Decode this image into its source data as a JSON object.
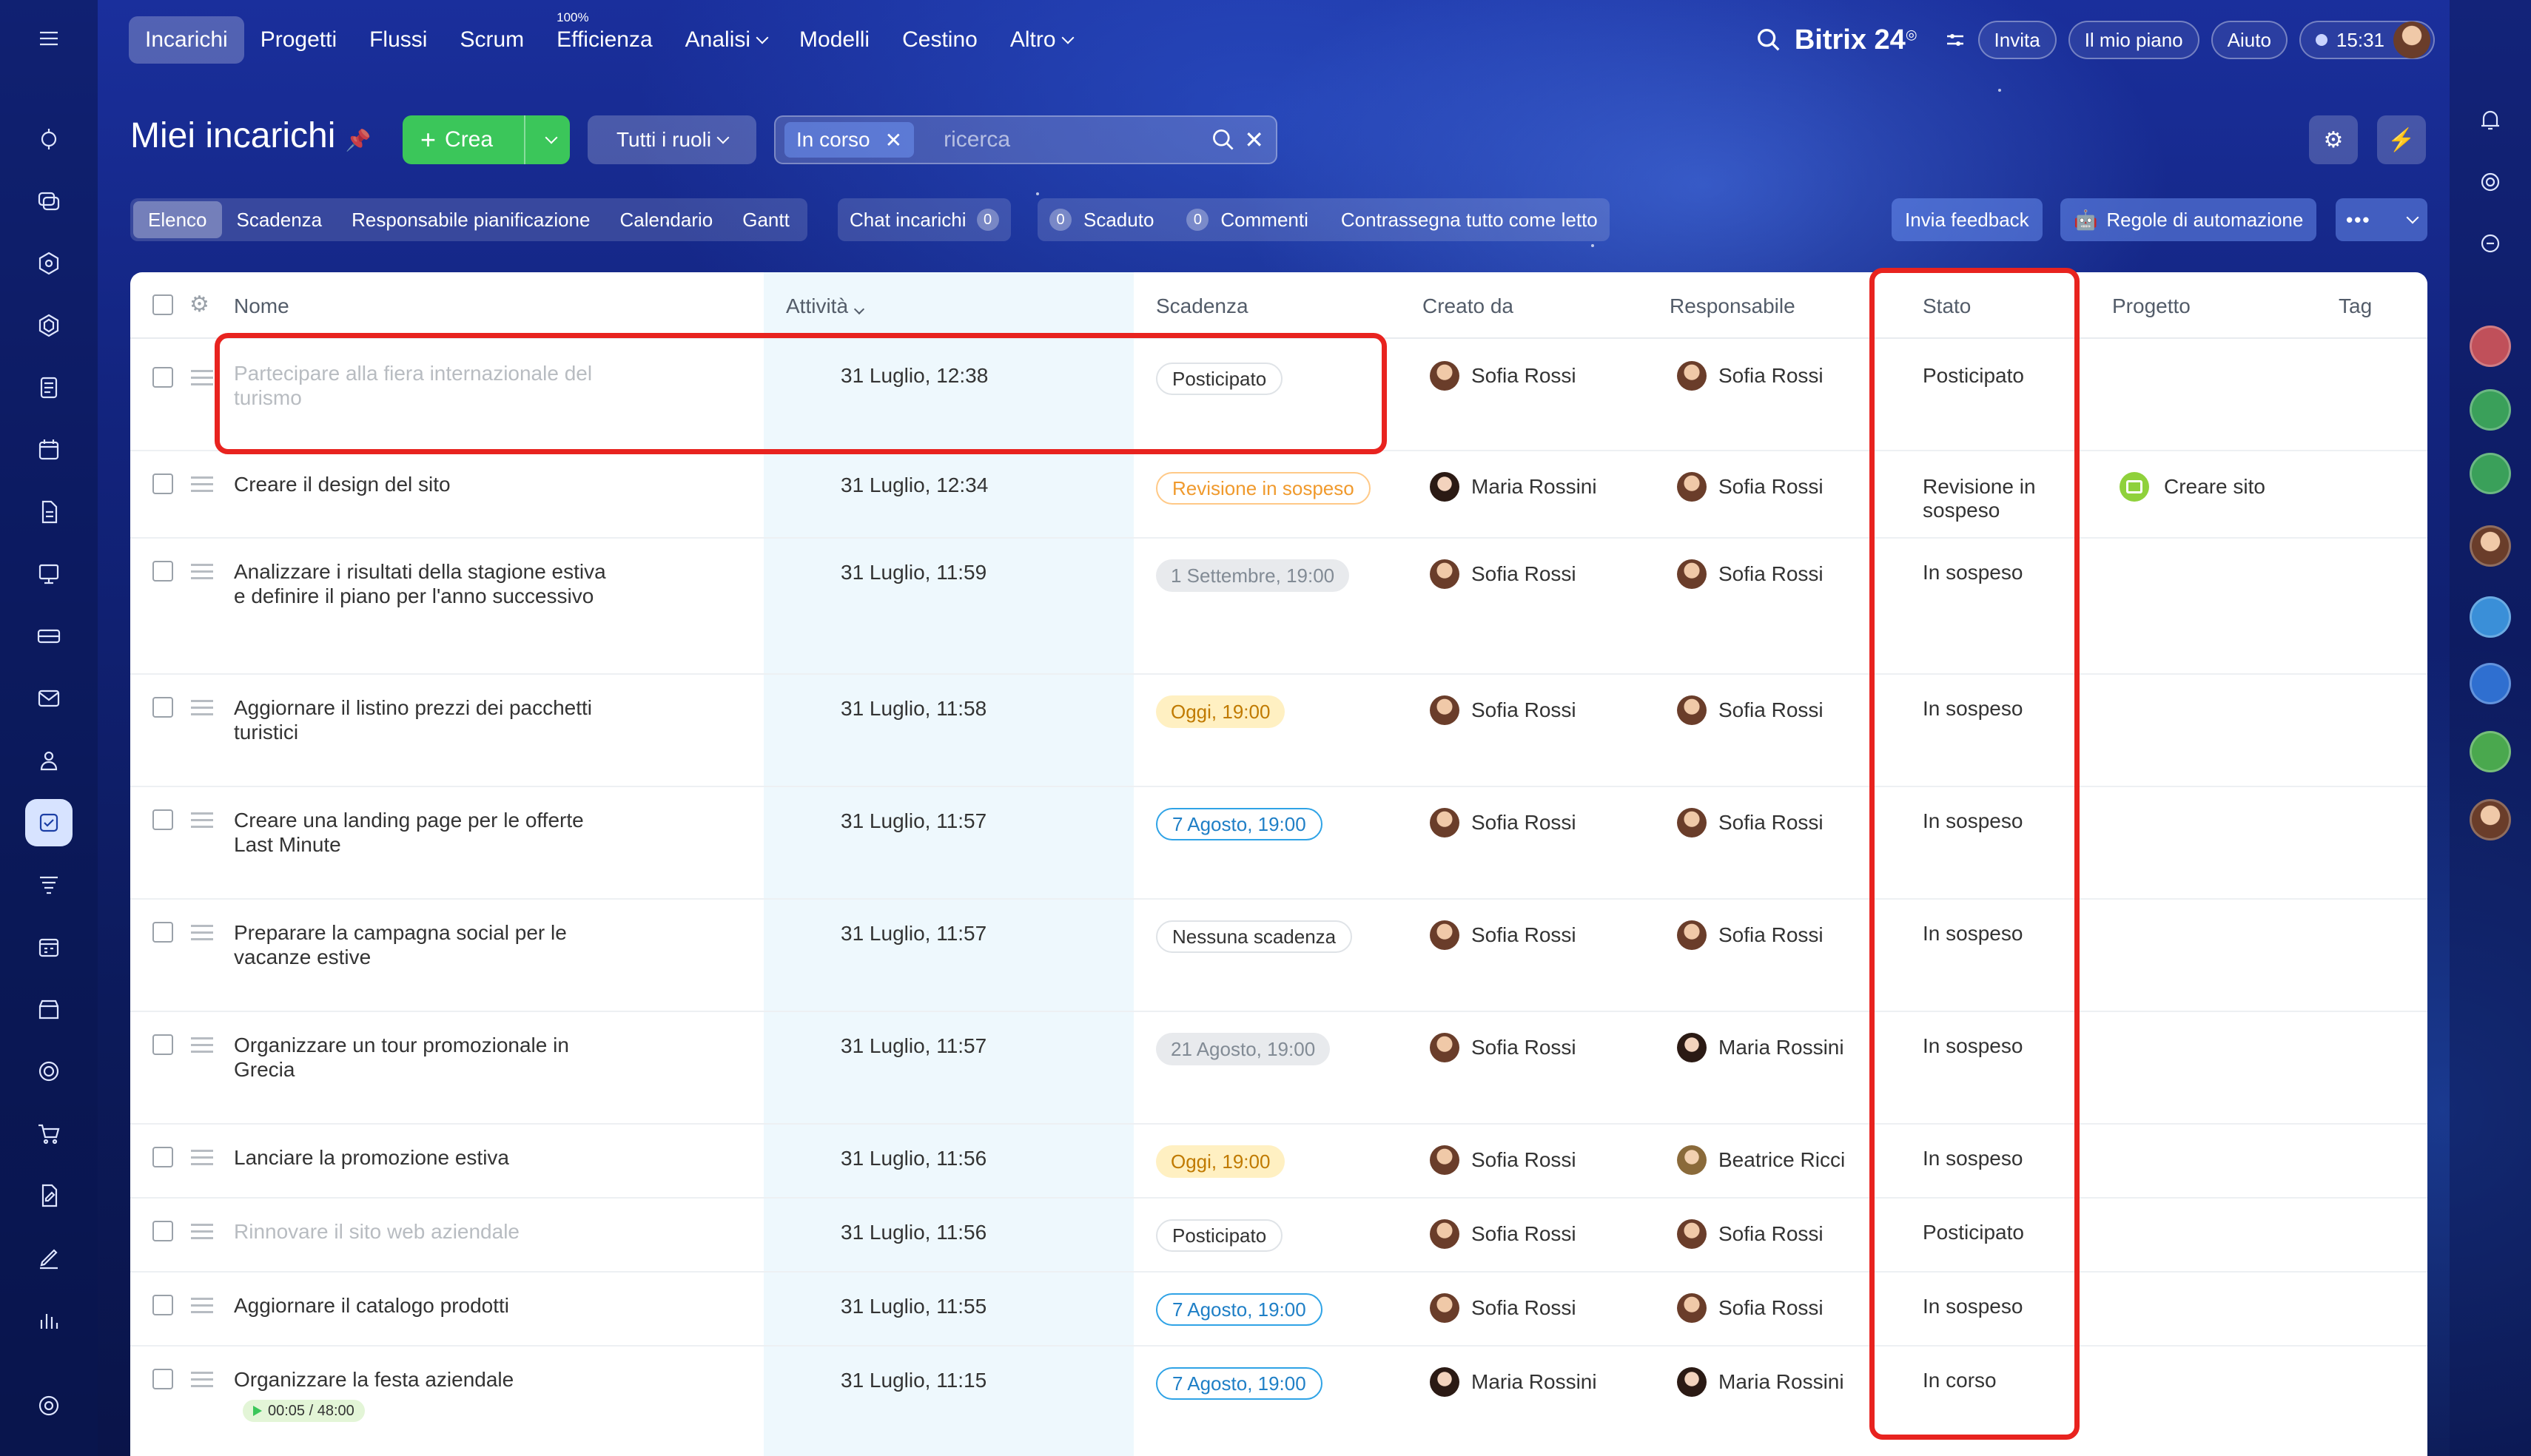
{
  "topnav": {
    "items": [
      "Incarichi",
      "Progetti",
      "Flussi",
      "Scrum",
      "Efficienza",
      "Analisi",
      "Modelli",
      "Cestino",
      "Altro"
    ],
    "efficiency_badge": "100%"
  },
  "topbar": {
    "brand": "Bitrix 24",
    "invite": "Invita",
    "plan": "Il mio piano",
    "help": "Aiuto",
    "time": "15:31"
  },
  "page": {
    "title": "Miei incarichi",
    "create": "Crea",
    "roles": "Tutti i ruoli",
    "filter_chip": "In corso",
    "search_placeholder": "ricerca"
  },
  "tabs": [
    "Elenco",
    "Scadenza",
    "Responsabile pianificazione",
    "Calendario",
    "Gantt"
  ],
  "counters": {
    "chat": "Chat incarichi",
    "chat_count": "0",
    "overdue_count": "0",
    "overdue": "Scaduto",
    "comments_count": "0",
    "comments": "Commenti",
    "mark_read": "Contrassegna tutto come letto"
  },
  "actions": {
    "feedback": "Invia feedback",
    "automation": "Regole di automazione"
  },
  "columns": {
    "name": "Nome",
    "activity": "Attività",
    "deadline": "Scadenza",
    "created_by": "Creato da",
    "responsible": "Responsabile",
    "status": "Stato",
    "project": "Progetto",
    "tag": "Tag"
  },
  "rows": [
    {
      "name": "Partecipare alla fiera internazionale del turismo",
      "activity": "31 Luglio, 12:38",
      "deadline": "Posticipato",
      "creator": "Sofia Rossi",
      "responsible": "Sofia Rossi",
      "status": "Posticipato",
      "project": ""
    },
    {
      "name": "Creare il design del sito",
      "activity": "31 Luglio, 12:34",
      "deadline": "Revisione in sospeso",
      "creator": "Maria Rossini",
      "responsible": "Sofia Rossi",
      "status": "Revisione in sospeso",
      "project": "Creare sito"
    },
    {
      "name": "Analizzare i risultati della stagione estiva e definire il piano per l'anno successivo",
      "activity": "31 Luglio, 11:59",
      "deadline": "1 Settembre, 19:00",
      "creator": "Sofia Rossi",
      "responsible": "Sofia Rossi",
      "status": "In sospeso",
      "project": ""
    },
    {
      "name": "Aggiornare il listino prezzi dei pacchetti turistici",
      "activity": "31 Luglio, 11:58",
      "deadline": "Oggi, 19:00",
      "creator": "Sofia Rossi",
      "responsible": "Sofia Rossi",
      "status": "In sospeso",
      "project": ""
    },
    {
      "name": "Creare una landing page per le offerte Last Minute",
      "activity": "31 Luglio, 11:57",
      "deadline": "7 Agosto, 19:00",
      "creator": "Sofia Rossi",
      "responsible": "Sofia Rossi",
      "status": "In sospeso",
      "project": ""
    },
    {
      "name": "Preparare la campagna social per le vacanze estive",
      "activity": "31 Luglio, 11:57",
      "deadline": "Nessuna scadenza",
      "creator": "Sofia Rossi",
      "responsible": "Sofia Rossi",
      "status": "In sospeso",
      "project": ""
    },
    {
      "name": "Organizzare un tour promozionale in Grecia",
      "activity": "31 Luglio, 11:57",
      "deadline": "21 Agosto, 19:00",
      "creator": "Sofia Rossi",
      "responsible": "Maria Rossini",
      "status": "In sospeso",
      "project": ""
    },
    {
      "name": "Lanciare la promozione estiva",
      "activity": "31 Luglio, 11:56",
      "deadline": "Oggi, 19:00",
      "creator": "Sofia Rossi",
      "responsible": "Beatrice Ricci",
      "status": "In sospeso",
      "project": ""
    },
    {
      "name": "Rinnovare il sito web aziendale",
      "activity": "31 Luglio, 11:56",
      "deadline": "Posticipato",
      "creator": "Sofia Rossi",
      "responsible": "Sofia Rossi",
      "status": "Posticipato",
      "project": ""
    },
    {
      "name": "Aggiornare il catalogo prodotti",
      "activity": "31 Luglio, 11:55",
      "deadline": "7 Agosto, 19:00",
      "creator": "Sofia Rossi",
      "responsible": "Sofia Rossi",
      "status": "In sospeso",
      "project": ""
    },
    {
      "name": "Organizzare la festa aziendale",
      "activity": "31 Luglio, 11:15",
      "deadline": "7 Agosto, 19:00",
      "creator": "Maria Rossini",
      "responsible": "Maria Rossini",
      "status": "In corso",
      "project": "",
      "timer": "00:05 / 48:00"
    }
  ],
  "colors": {
    "accent_green": "#3bc65a",
    "highlight_red": "#e8231f",
    "deadline_blue": "#2fa3e6",
    "deadline_orange": "#f09a2d"
  }
}
